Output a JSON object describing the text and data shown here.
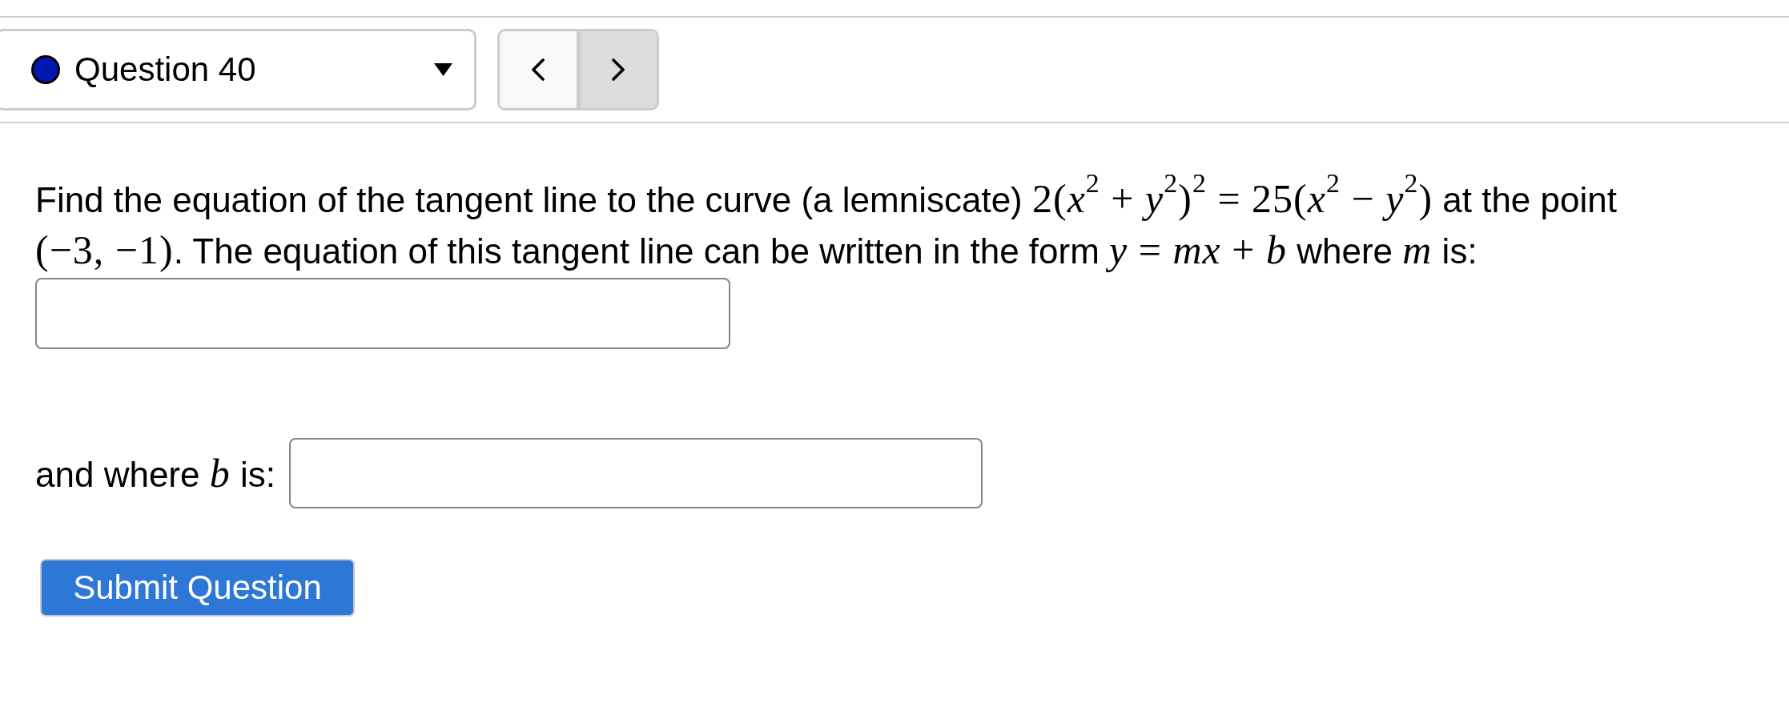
{
  "question_nav": {
    "selector": {
      "label": "Question 40",
      "color": "#0018b2"
    },
    "buttons": [
      {
        "kind": "prev",
        "highlighted": false
      },
      {
        "kind": "next",
        "highlighted": true
      }
    ]
  },
  "prompt": [
    {
      "kind": "text",
      "text": "Find the equation of the tangent line to the curve (a lemniscate) "
    },
    {
      "kind": "math",
      "text": "2(*x*$^{2}$ + *y*$^{2}$)$^{2}$ = 25(*x*$^{2}$ − *y*$^{2}$)"
    },
    {
      "kind": "text",
      "text": " at the point "
    },
    {
      "kind": "math",
      "text": "(−3, −1)"
    },
    {
      "kind": "text",
      "text": ". The equation of this tangent line can be written in the form "
    },
    {
      "kind": "math",
      "text": "*y* = *mx* + *b*"
    },
    {
      "kind": "text",
      "text": " where "
    },
    {
      "kind": "math",
      "text": "*m*"
    },
    {
      "kind": "text",
      "text": " is:"
    }
  ],
  "answers": [
    {
      "kind": "box"
    },
    {
      "kind": "labeled",
      "label": [
        {
          "kind": "text",
          "text": "and where "
        },
        {
          "kind": "math",
          "text": "*b*"
        },
        {
          "kind": "text",
          "text": " is:"
        }
      ]
    }
  ],
  "submit": {
    "label": "Submit Question"
  }
}
